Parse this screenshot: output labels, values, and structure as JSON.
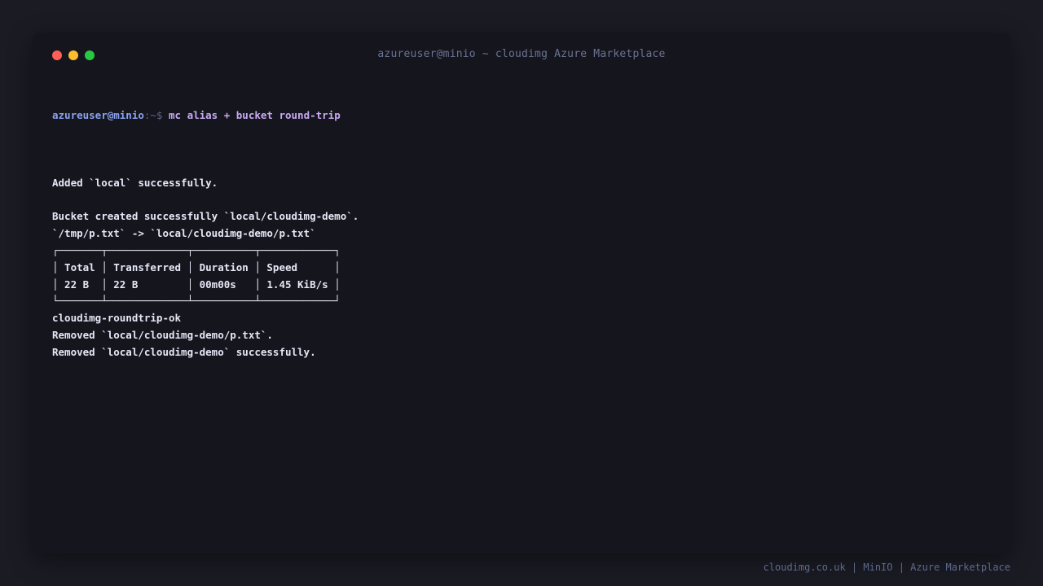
{
  "window": {
    "title": "azureuser@minio ~ cloudimg Azure Marketplace",
    "buttons": {
      "close_color": "#ff5f57",
      "minimize_color": "#febc2e",
      "maximize_color": "#28c840"
    }
  },
  "terminal": {
    "prompt": {
      "user_host": "azureuser@minio",
      "path": ":~$ ",
      "command": "mc alias + bucket round-trip"
    },
    "lines": [
      "",
      "Added `local` successfully.",
      "",
      "Bucket created successfully `local/cloudimg-demo`.",
      "`/tmp/p.txt` -> `local/cloudimg-demo/p.txt`",
      "┌───────┬─────────────┬──────────┬────────────┐",
      "│ Total │ Transferred │ Duration │ Speed      │",
      "│ 22 B  │ 22 B        │ 00m00s   │ 1.45 KiB/s │",
      "└───────┴─────────────┴──────────┴────────────┘",
      "cloudimg-roundtrip-ok",
      "Removed `local/cloudimg-demo/p.txt`.",
      "Removed `local/cloudimg-demo` successfully."
    ]
  },
  "footer": {
    "text": "cloudimg.co.uk | MinIO | Azure Marketplace"
  },
  "colors": {
    "background": "#1b1b24",
    "window": "#15151d",
    "prompt_user": "#8aa2f0",
    "command": "#c8aaf2",
    "output": "#e4e7f5"
  }
}
